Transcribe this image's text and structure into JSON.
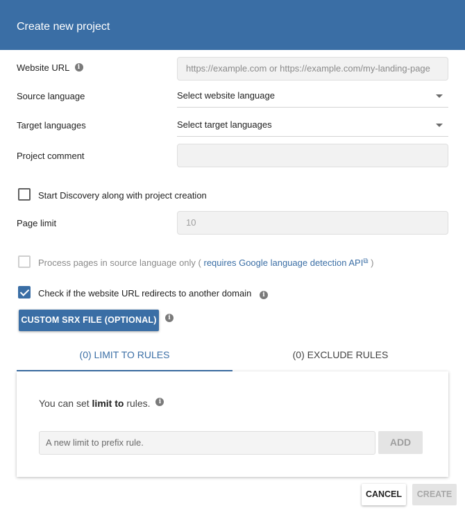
{
  "dialog": {
    "title": "Create new project"
  },
  "form": {
    "website_url": {
      "label": "Website URL",
      "placeholder": "https://example.com or https://example.com/my-landing-page"
    },
    "source_language": {
      "label": "Source language",
      "value": "Select website language"
    },
    "target_languages": {
      "label": "Target languages",
      "value": "Select target languages"
    },
    "project_comment": {
      "label": "Project comment",
      "value": ""
    },
    "discovery": {
      "label": "Start Discovery along with project creation",
      "checked": false
    },
    "page_limit": {
      "label": "Page limit",
      "value": "10"
    },
    "source_only": {
      "label_prefix": "Process pages in source language only (",
      "link_text": "requires Google language detection API",
      "label_suffix": ")",
      "checked": false,
      "disabled": true
    },
    "redirect_check": {
      "label": "Check if the website URL redirects to another domain",
      "checked": true
    },
    "custom_srx_button": "CUSTOM SRX FILE (OPTIONAL)"
  },
  "rules": {
    "tabs": [
      {
        "label": "(0) LIMIT TO RULES",
        "active": true
      },
      {
        "label": "(0) EXCLUDE RULES",
        "active": false
      }
    ],
    "hint_prefix": "You can set",
    "hint_bold": "limit to",
    "hint_suffix": "rules.",
    "input_placeholder": "A new limit to prefix rule.",
    "add_label": "ADD"
  },
  "footer": {
    "cancel_label": "CANCEL",
    "create_label": "CREATE"
  },
  "icons": {
    "info": "info-icon",
    "dropdown": "chevron-down-icon",
    "external": "external-link-icon"
  },
  "colors": {
    "brand": "#3a6ea5",
    "disabled": "#e4e4e4"
  }
}
